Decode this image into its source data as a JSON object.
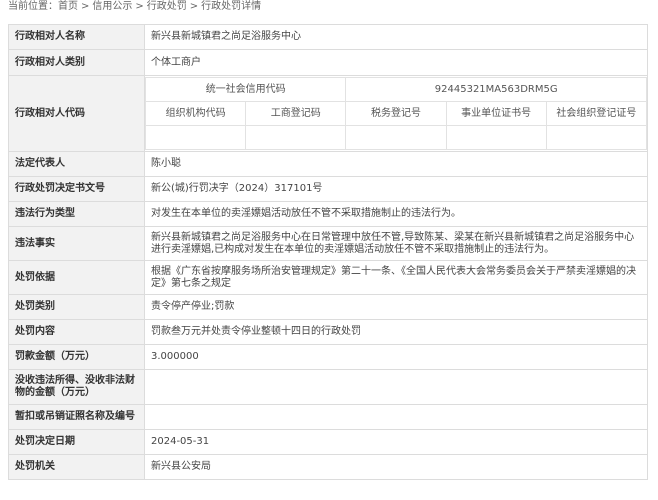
{
  "breadcrumb": {
    "prefix": "当前位置：",
    "items": [
      "首页",
      "信用公示",
      "行政处罚",
      "行政处罚详情"
    ],
    "separator": ">"
  },
  "detail": {
    "name": {
      "label": "行政相对人名称",
      "value": "新兴县新城镇君之尚足浴服务中心"
    },
    "category": {
      "label": "行政相对人类别",
      "value": "个体工商户"
    },
    "codes": {
      "label": "行政相对人代码",
      "credit_code_label": "统一社会信用代码",
      "credit_code_value": "92445321MA563DRM5G",
      "headers": [
        "组织机构代码",
        "工商登记码",
        "税务登记号",
        "事业单位证书号",
        "社会组织登记证号"
      ],
      "values": [
        "",
        "",
        "",
        "",
        ""
      ]
    },
    "legal_rep": {
      "label": "法定代表人",
      "value": "陈小聪"
    },
    "decision_no": {
      "label": "行政处罚决定书文号",
      "value": "新公(城)行罚决字（2024）317101号"
    },
    "violation_type": {
      "label": "违法行为类型",
      "value": "对发生在本单位的卖淫嫖娼活动放任不管不采取措施制止的违法行为。"
    },
    "facts": {
      "label": "违法事实",
      "value": "新兴县新城镇君之尚足浴服务中心在日常管理中放任不管,导致陈某、梁某在新兴县新城镇君之尚足浴服务中心进行卖淫嫖娼,已构成对发生在本单位的卖淫嫖娼活动放任不管不采取措施制止的违法行为。"
    },
    "basis": {
      "label": "处罚依据",
      "value": "根据《广东省按摩服务场所治安管理规定》第二十一条、《全国人民代表大会常务委员会关于严禁卖淫嫖娼的决定》第七条之规定"
    },
    "penalty_type": {
      "label": "处罚类别",
      "value": "责令停产停业;罚款"
    },
    "content": {
      "label": "处罚内容",
      "value": "罚款叁万元并处责令停业整顿十四日的行政处罚"
    },
    "amount": {
      "label": "罚款金额（万元）",
      "value": "3.000000"
    },
    "confiscated": {
      "label": "没收违法所得、没收非法财物的金额（万元）",
      "value": ""
    },
    "license": {
      "label": "暂扣或吊销证照名称及编号",
      "value": ""
    },
    "decision_date": {
      "label": "处罚决定日期",
      "value": "2024-05-31"
    },
    "authority": {
      "label": "处罚机关",
      "value": "新兴县公安局"
    }
  }
}
